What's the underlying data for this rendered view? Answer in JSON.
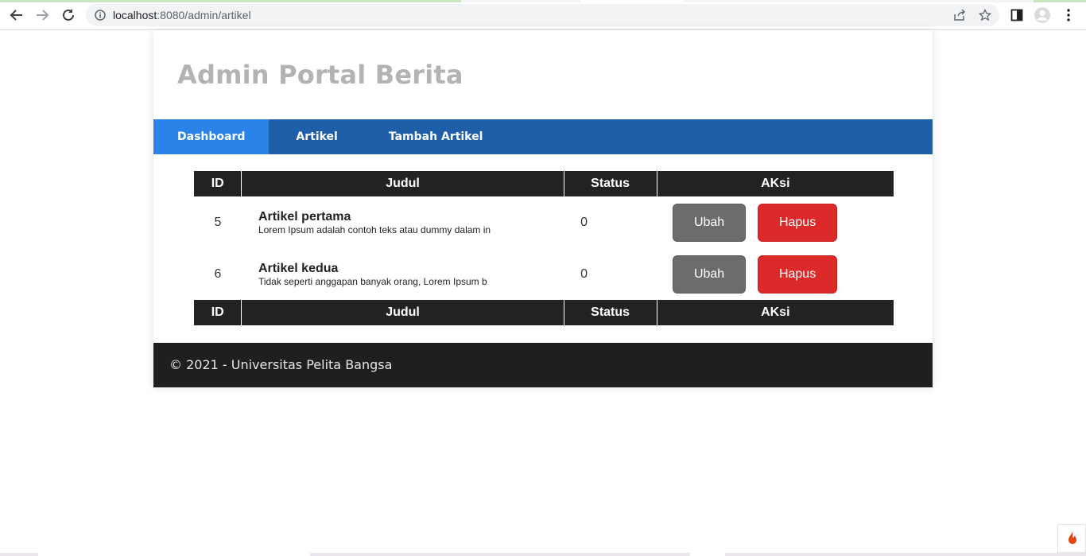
{
  "browser": {
    "url_host": "localhost",
    "url_rest": ":8080/admin/artikel"
  },
  "site": {
    "title": "Admin Portal Berita"
  },
  "nav": {
    "items": [
      {
        "label": "Dashboard",
        "active": true
      },
      {
        "label": "Artikel",
        "active": false
      },
      {
        "label": "Tambah Artikel",
        "active": false
      }
    ]
  },
  "table": {
    "headers": [
      "ID",
      "Judul",
      "Status",
      "AKsi"
    ],
    "rows": [
      {
        "id": "5",
        "title": "Artikel pertama",
        "excerpt": "Lorem Ipsum adalah contoh teks atau dummy dalam in",
        "status": "0",
        "edit_label": "Ubah",
        "delete_label": "Hapus"
      },
      {
        "id": "6",
        "title": "Artikel kedua",
        "excerpt": "Tidak seperti anggapan banyak orang, Lorem Ipsum b",
        "status": "0",
        "edit_label": "Ubah",
        "delete_label": "Hapus"
      }
    ]
  },
  "footer": {
    "text": "© 2021 - Universitas Pelita Bangsa"
  },
  "colors": {
    "nav_bg": "#1f5faa",
    "nav_active": "#2b83ea",
    "table_header": "#222222",
    "edit_button": "#6c6c6c",
    "delete_button": "#dc2a2a",
    "footer_bg": "#1f1f1f",
    "title_color": "#b3b3b3"
  }
}
